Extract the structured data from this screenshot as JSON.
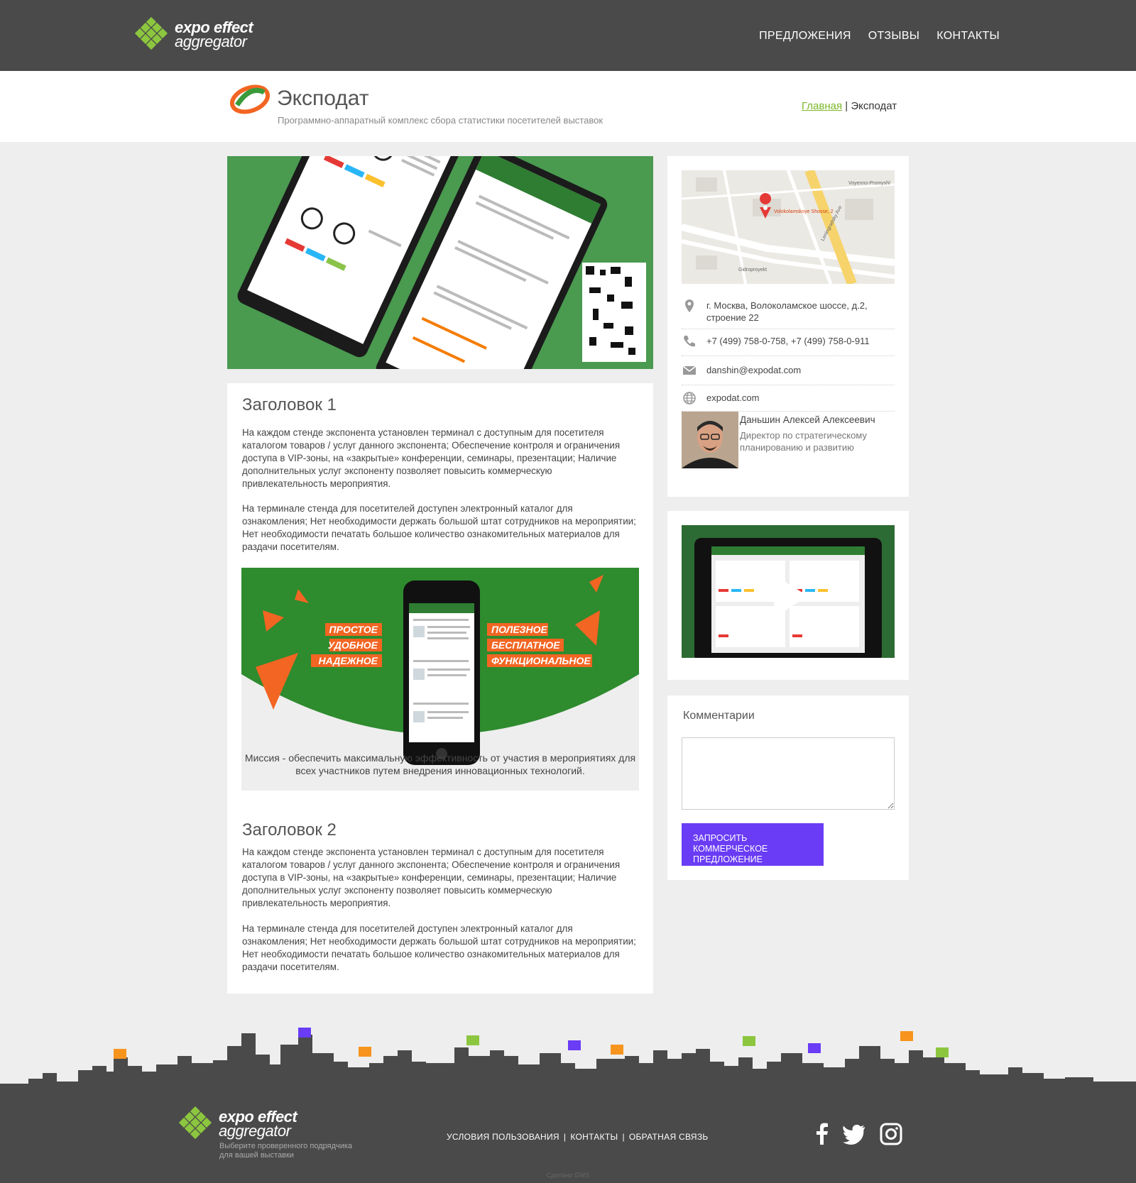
{
  "header": {
    "logo": {
      "line1": "expo effect",
      "line2": "aggregator"
    },
    "nav": [
      "ПРЕДЛОЖЕНИЯ",
      "ОТЗЫВЫ",
      "КОНТАКТЫ"
    ]
  },
  "page": {
    "title": "Эксподат",
    "subtitle": "Программно-аппаратный комплекс сбора статистики посетителей выставок",
    "breadcrumb": {
      "home": "Главная",
      "separator": "|",
      "current": "Эксподат"
    }
  },
  "article": {
    "heading1": "Заголовок 1",
    "p1": "На каждом стенде экспонента установлен терминал с доступным для посетителя каталогом товаров / услуг данного экспонента; Обеспечение контроля и ограничения доступа в VIP-зоны, на «закрытые» конференции, семинары, презентации; Наличие дополнительных услуг экспоненту позволяет повысить коммерческую привлекательность мероприятия.",
    "p2": "На терминале стенда для посетителей доступен электронный каталог для ознакомления; Нет необходимости держать большой штат сотрудников на мероприятии; Нет необходимости печатать большое количество ознакомительных материалов для раздачи посетителям.",
    "promo": {
      "left": [
        "ПРОСТОЕ",
        "УДОБНОЕ",
        "НАДЕЖНОЕ"
      ],
      "right": [
        "ПОЛЕЗНОЕ",
        "БЕСПЛАТНОЕ",
        "ФУНКЦИОНАЛЬНОЕ"
      ],
      "caption": "Миссия - обеспечить максимальную эффективность от участия в мероприятиях для всех участников путем внедрения инновационных технологий."
    },
    "heading2": "Заголовок 2",
    "p3": "На каждом стенде экспонента установлен терминал с доступным для посетителя каталогом товаров / услуг данного экспонента; Обеспечение контроля и ограничения доступа в VIP-зоны, на «закрытые» конференции, семинары, презентации; Наличие дополнительных услуг экспоненту позволяет повысить коммерческую привлекательность мероприятия.",
    "p4": "На терминале стенда для посетителей доступен электронный каталог для ознакомления; Нет необходимости держать большой штат сотрудников на мероприятии; Нет необходимости печатать большое количество ознакомительных материалов для раздачи посетителям."
  },
  "contact": {
    "map_labels": [
      "Volokolamskoye Shosse, 2",
      "Leningradsky Ave",
      "Gidroproyekt",
      "Voyenno-Promyshl"
    ],
    "address": "г. Москва, Волоколамское шоссе, д.2, строение 22",
    "phone": "+7 (499) 758-0-758, +7 (499) 758-0-911",
    "email": "danshin@expodat.com",
    "site": "expodat.com",
    "person_name": "Даньшин Алексей Алексеевич",
    "person_role": "Директор по стратегическому планированию и развитию"
  },
  "comments": {
    "title": "Комментарии",
    "placeholder": "",
    "button": "ЗАПРОСИТЬ КОММЕРЧЕСКОЕ ПРЕДЛОЖЕНИЕ"
  },
  "footer": {
    "logo": {
      "line1": "expo effect",
      "line2": "aggregator"
    },
    "tagline": "Выберите проверенного подрядчика для вашей выставки",
    "links": [
      "УСЛОВИЯ ПОЛЬЗОВАНИЯ",
      "КОНТАКТЫ",
      "ОБРАТНАЯ СВЯЗЬ"
    ],
    "credit": "Сделано GWS"
  },
  "colors": {
    "accent_green": "#7bb829",
    "button_purple": "#6a3cf5",
    "header_bg": "#4a4a4a",
    "promo_orange": "#f26522",
    "promo_green": "#2e8b2e"
  },
  "icons": [
    "location-pin-icon",
    "phone-icon",
    "mail-icon",
    "globe-icon",
    "play-icon",
    "facebook-icon",
    "twitter-icon",
    "instagram-icon"
  ]
}
